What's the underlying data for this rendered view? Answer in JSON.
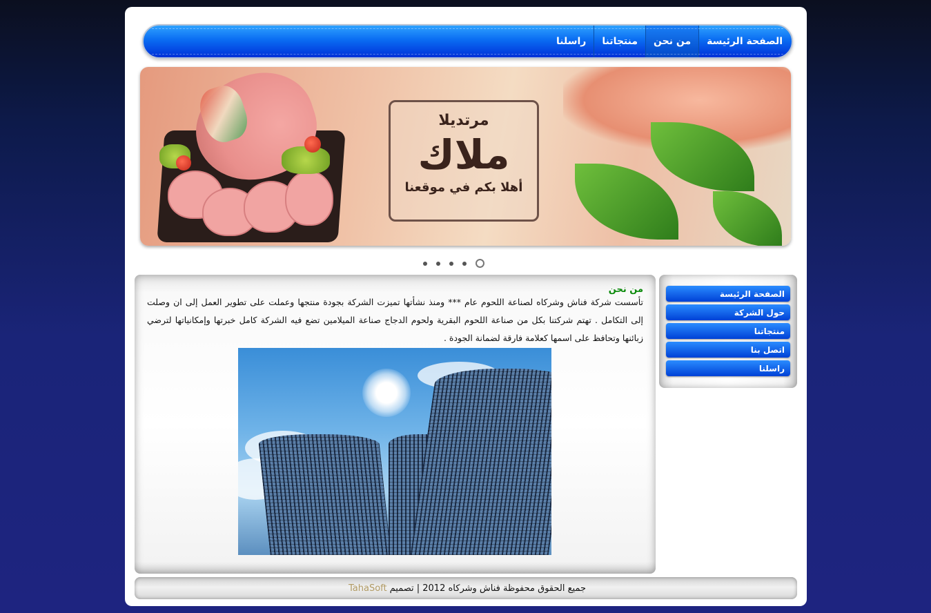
{
  "nav": {
    "items": [
      {
        "label": "الصفحة الرئيسة"
      },
      {
        "label": "من نحن"
      },
      {
        "label": "منتجاتنا"
      },
      {
        "label": "راسلنا"
      }
    ]
  },
  "banner": {
    "small": "مرتديلا",
    "brand": "ملاك",
    "welcome": "أهلا بكم في موقعنا"
  },
  "slider": {
    "count": 5,
    "active": 1
  },
  "content": {
    "title": "من نحن",
    "body": "تأسست شركة فناش وشركاه لصناعة اللحوم عام *** ومنذ نشأتها تميزت الشركة بجودة منتجها وعملت على تطوير العمل إلى ان وصلت إلى التكامل . تهتم شركتنا بكل من صناعة اللحوم البقرية ولحوم الدجاج صناعة الميلامين تضع فيه الشركة كامل خبرتها وإمكانياتها لترضي زبائنها وتحافظ على اسمها كعلامة فارقة لضمانة الجودة ."
  },
  "side_menu": {
    "items": [
      {
        "label": "الصفحة الرئيسة"
      },
      {
        "label": "حول الشركة"
      },
      {
        "label": "منتجاتنا"
      },
      {
        "label": "اتصل بنا"
      },
      {
        "label": "راسلنا"
      }
    ]
  },
  "footer": {
    "rights": "جميع الحقوق محفوظة فناش وشركاه 2012 | تصميم",
    "brand": "TahaSoft"
  },
  "colors": {
    "nav_blue": "#0a6cf2",
    "title_green": "#0a8a0a",
    "brand_gold": "#b19a63"
  }
}
